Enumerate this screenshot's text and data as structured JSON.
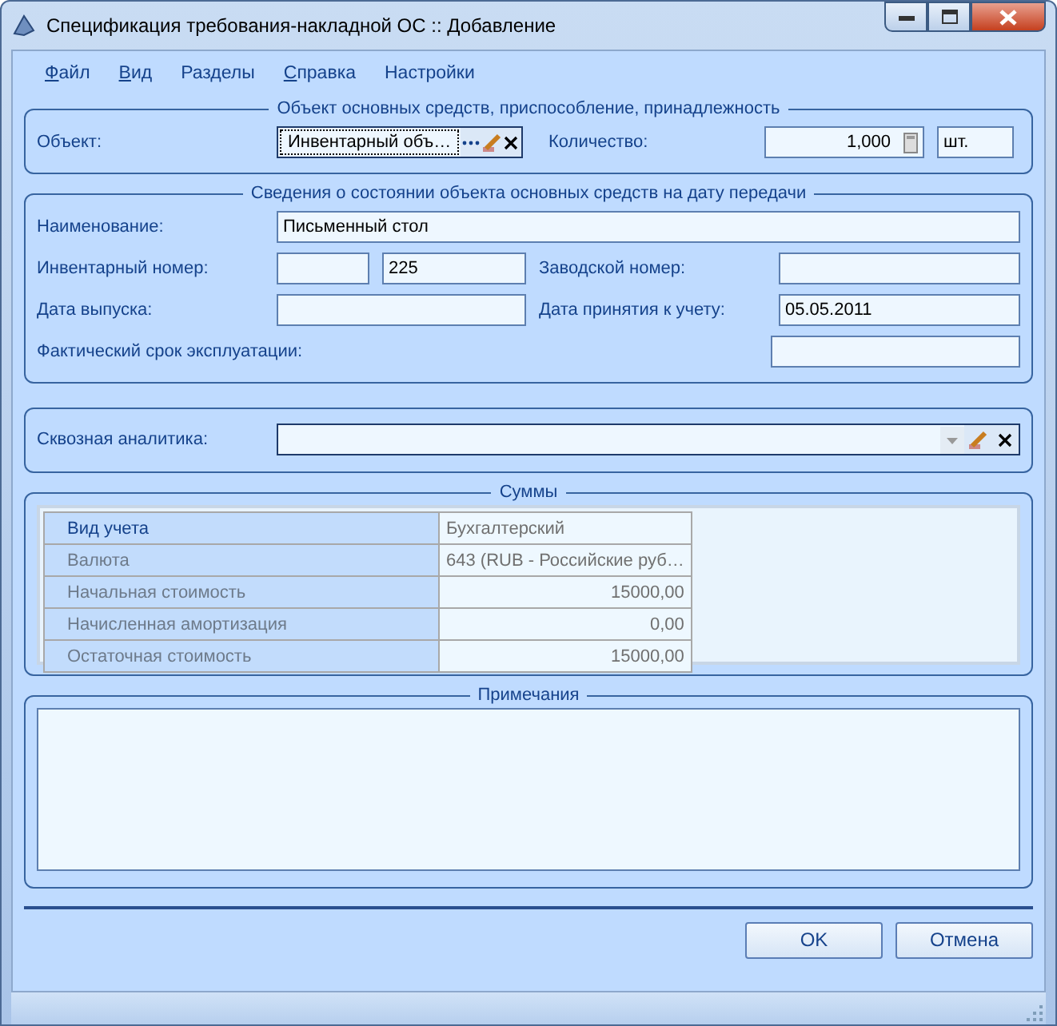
{
  "window": {
    "title": "Спецификация требования-накладной ОС :: Добавление"
  },
  "menu": [
    {
      "label": "Файл",
      "underlined": true
    },
    {
      "label": "Вид",
      "underlined": true
    },
    {
      "label": "Разделы",
      "underlined": false
    },
    {
      "label": "Справка",
      "underlined": true
    },
    {
      "label": "Настройки",
      "underlined": false
    }
  ],
  "object_group": {
    "title": "Объект основных средств, приспособление, принадлежность",
    "object_label": "Объект:",
    "object_value": "Инвентарный объ…",
    "quantity_label": "Количество:",
    "quantity_value": "1,000",
    "unit": "шт."
  },
  "state_group": {
    "title": "Сведения о состоянии объекта основных средств на дату передачи",
    "name_label": "Наименование:",
    "name_value": "Письменный стол",
    "inventory_label": "Инвентарный номер:",
    "inventory_value": "225",
    "factory_label": "Заводской номер:",
    "release_label": "Дата выпуска:",
    "accept_label": "Дата принятия к учету:",
    "accept_value": "05.05.2011",
    "service_label": "Фактический срок эксплуатации:"
  },
  "analytics": {
    "label": "Сквозная аналитика:"
  },
  "sums": {
    "title": "Суммы",
    "rows": [
      {
        "label": "Вид учета",
        "value": "Бухгалтерский",
        "kind": "text",
        "selected": true
      },
      {
        "label": "Валюта",
        "value": "643 (RUB - Российские руб…",
        "kind": "text",
        "selected": false
      },
      {
        "label": "Начальная стоимость",
        "value": "15000,00",
        "kind": "amount",
        "selected": false
      },
      {
        "label": "Начисленная амортизация",
        "value": "0,00",
        "kind": "amount",
        "selected": false
      },
      {
        "label": "Остаточная стоимость",
        "value": "15000,00",
        "kind": "amount",
        "selected": false
      }
    ]
  },
  "notes": {
    "title": "Примечания"
  },
  "buttons": [
    {
      "label": "OK"
    },
    {
      "label": "Отмена"
    }
  ]
}
